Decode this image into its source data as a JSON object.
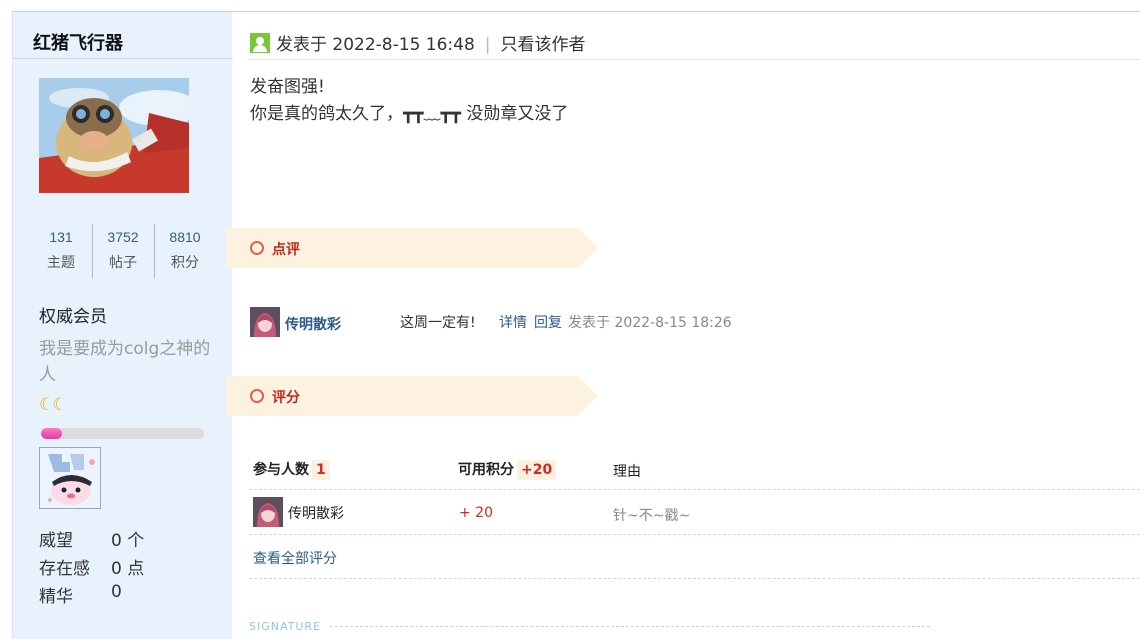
{
  "author": {
    "name": "红猪飞行器",
    "stats": [
      {
        "value": "131",
        "label": "主题"
      },
      {
        "value": "3752",
        "label": "帖子"
      },
      {
        "value": "8810",
        "label": "积分"
      }
    ],
    "group": "权威会员",
    "custom_title": "我是要成为colg之神的人",
    "level_progress": 0.13,
    "attributes": [
      {
        "label": "威望",
        "value": "0 个"
      },
      {
        "label": "存在感",
        "value": "0 点"
      },
      {
        "label": "精华",
        "value": "0"
      }
    ]
  },
  "post": {
    "posted_at": "发表于 2022-8-15 16:48",
    "author_only": "只看该作者",
    "lines": [
      "发奋图强!",
      "你是真的鸽太久了，┳┳﹏┳┳ 没勋章又没了"
    ]
  },
  "comment_section": {
    "title": "点评",
    "items": [
      {
        "user": "传明散彩",
        "message": "这周一定有!",
        "detail": "详情",
        "reply": "回复",
        "time": "发表于 2022-8-15 18:26"
      }
    ]
  },
  "rating_section": {
    "title": "评分",
    "participants_label": "参与人数",
    "participants": "1",
    "points_label": "可用积分",
    "points_total": "+20",
    "reason_label": "理由",
    "rows": [
      {
        "user": "传明散彩",
        "points": "+ 20",
        "reason": "针~不~戳~"
      }
    ],
    "view_all": "查看全部评分"
  },
  "signature_label": "SIGNATURE",
  "colors": {
    "sidebar_bg": "#e8f2fc",
    "link": "#2d5a86",
    "accent_red": "#c0281e",
    "banner_bg": "#fdf2e0",
    "online": "#7dc63a"
  }
}
